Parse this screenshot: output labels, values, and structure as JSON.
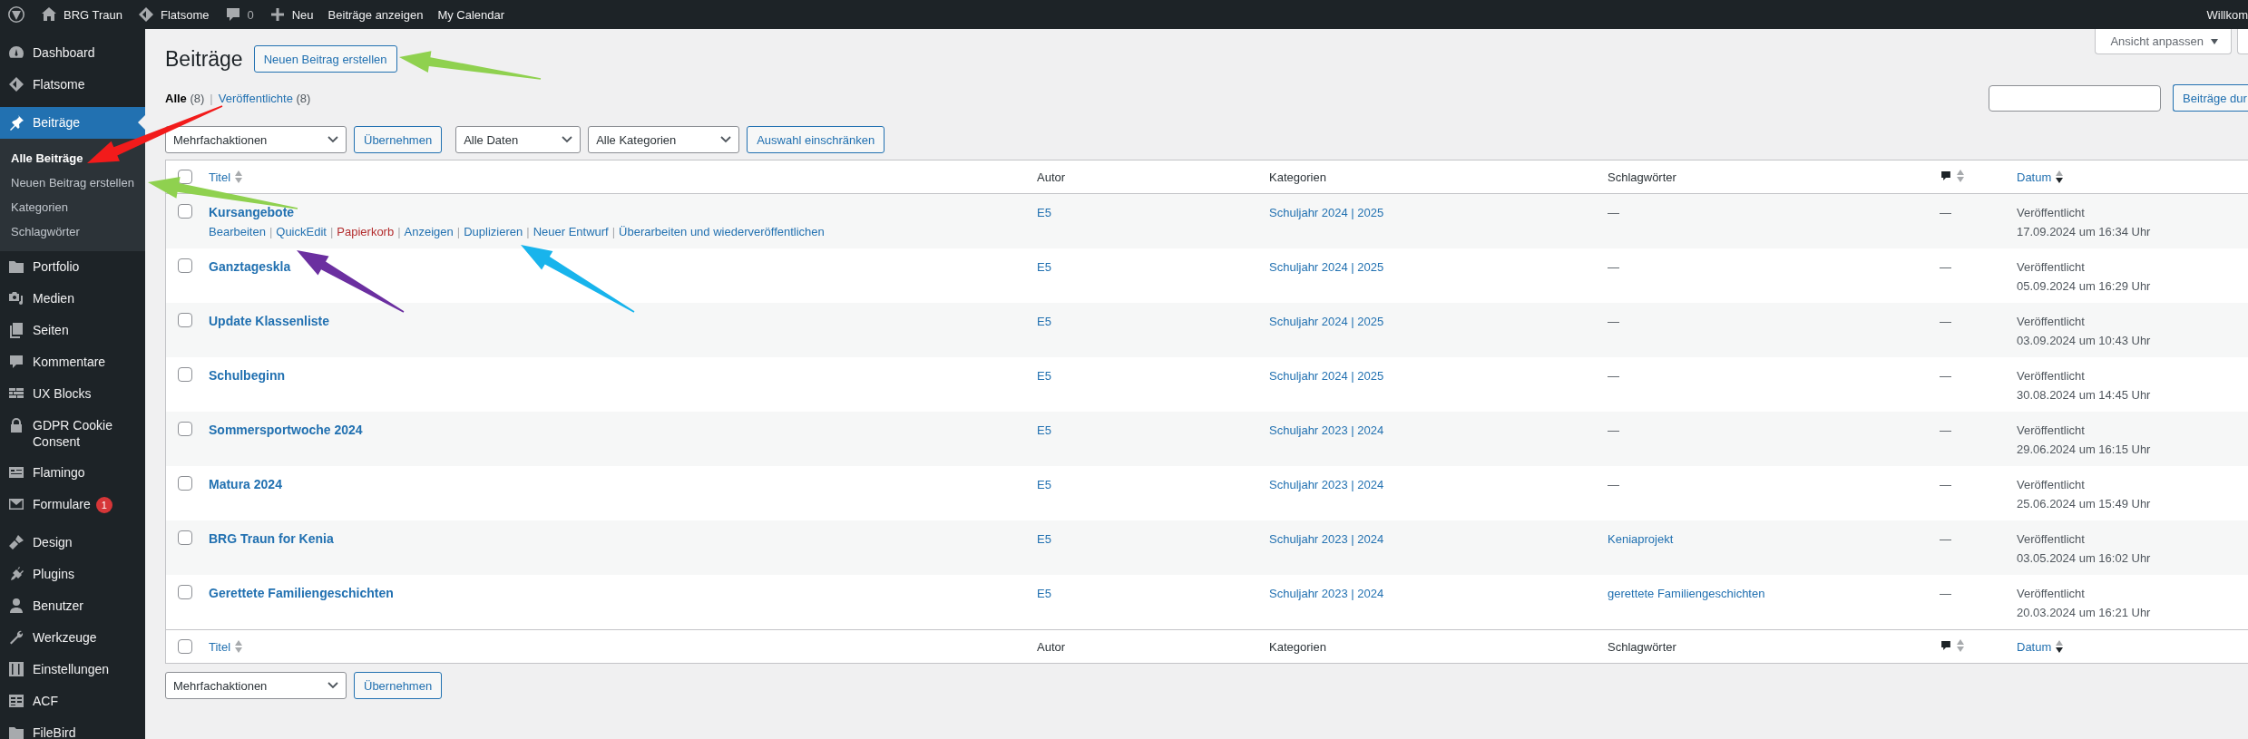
{
  "top_bar": {
    "items": [
      {
        "kind": "site",
        "label": "BRG Traun"
      },
      {
        "kind": "theme",
        "label": "Flatsome"
      },
      {
        "kind": "comments",
        "label": "0"
      },
      {
        "kind": "new",
        "label": "Neu"
      },
      {
        "kind": "link",
        "label": "Beiträge anzeigen"
      },
      {
        "kind": "link",
        "label": "My Calendar"
      }
    ],
    "greeting": "Willkom"
  },
  "sidebar": {
    "groups": [
      [
        {
          "label": "Dashboard",
          "selected": false
        },
        {
          "label": "Flatsome",
          "selected": false
        }
      ],
      [
        {
          "label": "Beiträge",
          "selected": true,
          "children": [
            {
              "label": "Alle Beiträge",
              "selected": true
            },
            {
              "label": "Neuen Beitrag erstellen",
              "selected": false
            },
            {
              "label": "Kategorien",
              "selected": false
            },
            {
              "label": "Schlagwörter",
              "selected": false
            }
          ]
        },
        {
          "label": "Portfolio",
          "selected": false
        },
        {
          "label": "Medien",
          "selected": false
        },
        {
          "label": "Seiten",
          "selected": false
        },
        {
          "label": "Kommentare",
          "selected": false
        },
        {
          "label": "UX Blocks",
          "selected": false
        },
        {
          "label": "GDPR Cookie Consent",
          "selected": false
        },
        {
          "label": "Flamingo",
          "selected": false
        },
        {
          "label": "Formulare",
          "selected": false,
          "badge": "1"
        }
      ],
      [
        {
          "label": "Design",
          "selected": false
        },
        {
          "label": "Plugins",
          "selected": false
        },
        {
          "label": "Benutzer",
          "selected": false
        },
        {
          "label": "Werkzeuge",
          "selected": false
        },
        {
          "label": "Einstellungen",
          "selected": false
        },
        {
          "label": "ACF",
          "selected": false
        },
        {
          "label": "FileBird",
          "selected": false
        }
      ]
    ]
  },
  "screen_options": {
    "label": "Ansicht anpassen"
  },
  "page": {
    "title": "Beiträge",
    "add_button": "Neuen Beitrag erstellen"
  },
  "views": [
    {
      "label": "Alle",
      "count": "(8)",
      "selected": true
    },
    {
      "label": "Veröffentlichte",
      "count": "(8)",
      "selected": false
    }
  ],
  "views_separator": "|",
  "search": {
    "button": "Beiträge dur"
  },
  "top_actions": {
    "bulk": "Mehrfachaktionen",
    "apply": "Übernehmen",
    "dates": "Alle Daten",
    "categories": "Alle Kategorien",
    "filter": "Auswahl einschränken"
  },
  "table": {
    "header": [
      {
        "kind": "checkbox",
        "checked": false
      },
      {
        "kind": "sortable",
        "label": "Titel",
        "sorted": false
      },
      {
        "kind": "plain",
        "label": "Autor"
      },
      {
        "kind": "plain",
        "label": "Kategorien"
      },
      {
        "kind": "plain",
        "label": "Schlagwörter"
      },
      {
        "kind": "comments",
        "sorted": false
      },
      {
        "kind": "sortable",
        "label": "Datum",
        "sorted": true
      }
    ],
    "rows": [
      {
        "checked": false,
        "title": "Kursangebote",
        "actions": [
          {
            "kind": "link",
            "label": "Bearbeiten"
          },
          {
            "kind": "separator",
            "label": "|"
          },
          {
            "kind": "link",
            "label": "QuickEdit"
          },
          {
            "kind": "separator",
            "label": "|"
          },
          {
            "kind": "danger",
            "label": "Papierkorb"
          },
          {
            "kind": "separator",
            "label": "|"
          },
          {
            "kind": "link",
            "label": "Anzeigen"
          },
          {
            "kind": "separator",
            "label": "|"
          },
          {
            "kind": "link",
            "label": "Duplizieren"
          },
          {
            "kind": "separator",
            "label": "|"
          },
          {
            "kind": "link",
            "label": "Neuer Entwurf"
          },
          {
            "kind": "separator",
            "label": "|"
          },
          {
            "kind": "link",
            "label": "Überarbeiten und wiederveröffentlichen"
          }
        ],
        "author": "E5",
        "categories": "Schuljahr 2024 | 2025",
        "tags": "—",
        "tags_link": false,
        "comments": "—",
        "status": "Veröffentlicht",
        "date": "17.09.2024 um 16:34 Uhr"
      },
      {
        "checked": false,
        "title": "Ganztageskla",
        "author": "E5",
        "categories": "Schuljahr 2024 | 2025",
        "tags": "—",
        "tags_link": false,
        "comments": "—",
        "status": "Veröffentlicht",
        "date": "05.09.2024 um 16:29 Uhr"
      },
      {
        "checked": false,
        "title": "Update Klassenliste",
        "author": "E5",
        "categories": "Schuljahr 2024 | 2025",
        "tags": "—",
        "tags_link": false,
        "comments": "—",
        "status": "Veröffentlicht",
        "date": "03.09.2024 um 10:43 Uhr"
      },
      {
        "checked": false,
        "title": "Schulbeginn",
        "author": "E5",
        "categories": "Schuljahr 2024 | 2025",
        "tags": "—",
        "tags_link": false,
        "comments": "—",
        "status": "Veröffentlicht",
        "date": "30.08.2024 um 14:45 Uhr"
      },
      {
        "checked": false,
        "title": "Sommersportwoche 2024",
        "author": "E5",
        "categories": "Schuljahr 2023 | 2024",
        "tags": "—",
        "tags_link": false,
        "comments": "—",
        "status": "Veröffentlicht",
        "date": "29.06.2024 um 16:15 Uhr"
      },
      {
        "checked": false,
        "title": "Matura 2024",
        "author": "E5",
        "categories": "Schuljahr 2023 | 2024",
        "tags": "—",
        "tags_link": false,
        "comments": "—",
        "status": "Veröffentlicht",
        "date": "25.06.2024 um 15:49 Uhr"
      },
      {
        "checked": false,
        "title": "BRG Traun for Kenia",
        "author": "E5",
        "categories": "Schuljahr 2023 | 2024",
        "tags": "Keniaprojekt",
        "tags_link": true,
        "comments": "—",
        "status": "Veröffentlicht",
        "date": "03.05.2024 um 16:02 Uhr"
      },
      {
        "checked": false,
        "title": "Gerettete Familiengeschichten",
        "author": "E5",
        "categories": "Schuljahr 2023 | 2024",
        "tags": "gerettete Familiengeschichten",
        "tags_link": true,
        "comments": "—",
        "status": "Veröffentlicht",
        "date": "20.03.2024 um 16:21 Uhr"
      }
    ],
    "footer": [
      {
        "kind": "checkbox",
        "checked": false
      },
      {
        "kind": "sortable",
        "label": "Titel",
        "sorted": false
      },
      {
        "kind": "plain",
        "label": "Autor"
      },
      {
        "kind": "plain",
        "label": "Kategorien"
      },
      {
        "kind": "plain",
        "label": "Schlagwörter"
      },
      {
        "kind": "comments",
        "sorted": false
      },
      {
        "kind": "sortable",
        "label": "Datum",
        "sorted": true
      }
    ]
  },
  "bottom_actions": {
    "bulk": "Mehrfachaktionen",
    "apply": "Übernehmen"
  },
  "annotations": [
    {
      "color": "#8fd14f"
    },
    {
      "color": "#f21b1b"
    },
    {
      "color": "#8fd14f"
    },
    {
      "color": "#6b2fa0"
    },
    {
      "color": "#18b4ec"
    }
  ]
}
